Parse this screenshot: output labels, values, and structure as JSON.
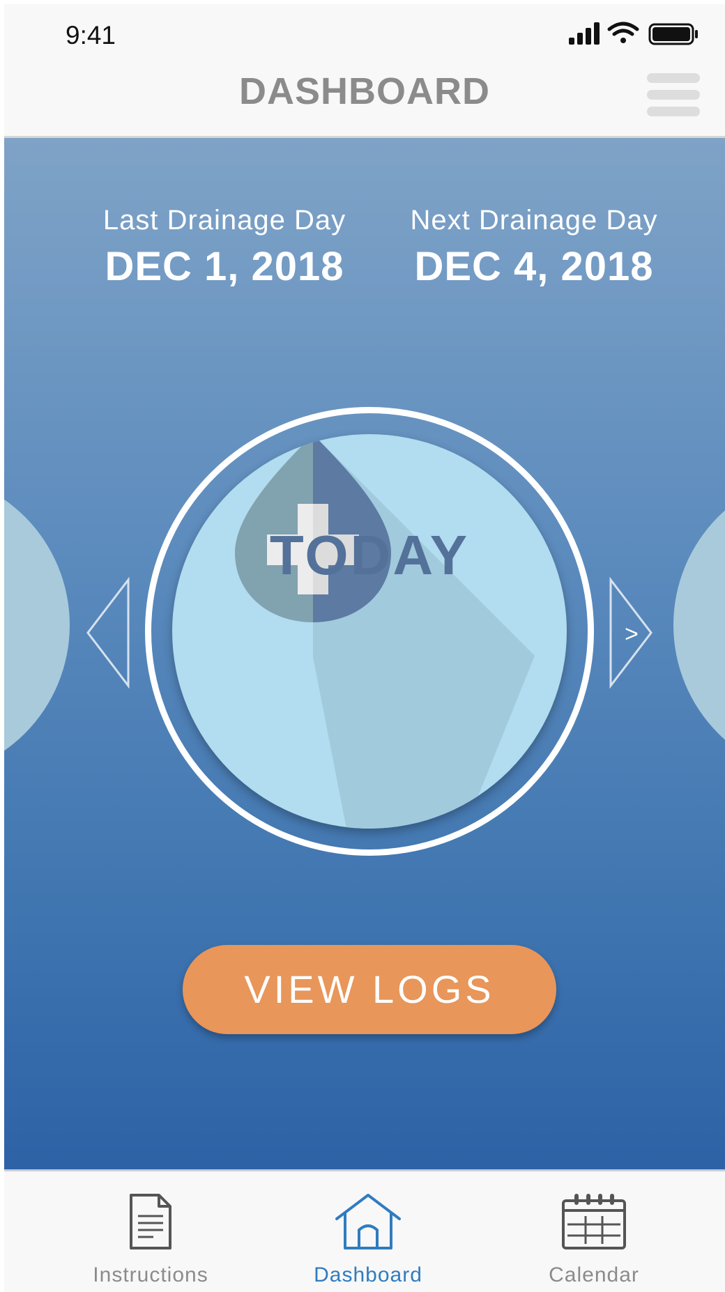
{
  "status_bar": {
    "time": "9:41"
  },
  "nav": {
    "title": "DASHBOARD"
  },
  "drainage": {
    "last_label": "Last Drainage Day",
    "last_date": "DEC 1, 2018",
    "next_label": "Next Drainage Day",
    "next_date": "DEC 4, 2018"
  },
  "carousel": {
    "current_label": "TODAY",
    "next_glyph": ">"
  },
  "actions": {
    "view_logs_label": "VIEW LOGS"
  },
  "tabs": [
    {
      "label": "Instructions",
      "icon": "document-icon",
      "active": false
    },
    {
      "label": "Dashboard",
      "icon": "home-icon",
      "active": true
    },
    {
      "label": "Calendar",
      "icon": "calendar-icon",
      "active": false
    }
  ],
  "colors": {
    "accent_orange": "#e8965a",
    "active_tab": "#2f7cc0",
    "today_disc": "#b2dcef",
    "today_text": "#54719a"
  }
}
